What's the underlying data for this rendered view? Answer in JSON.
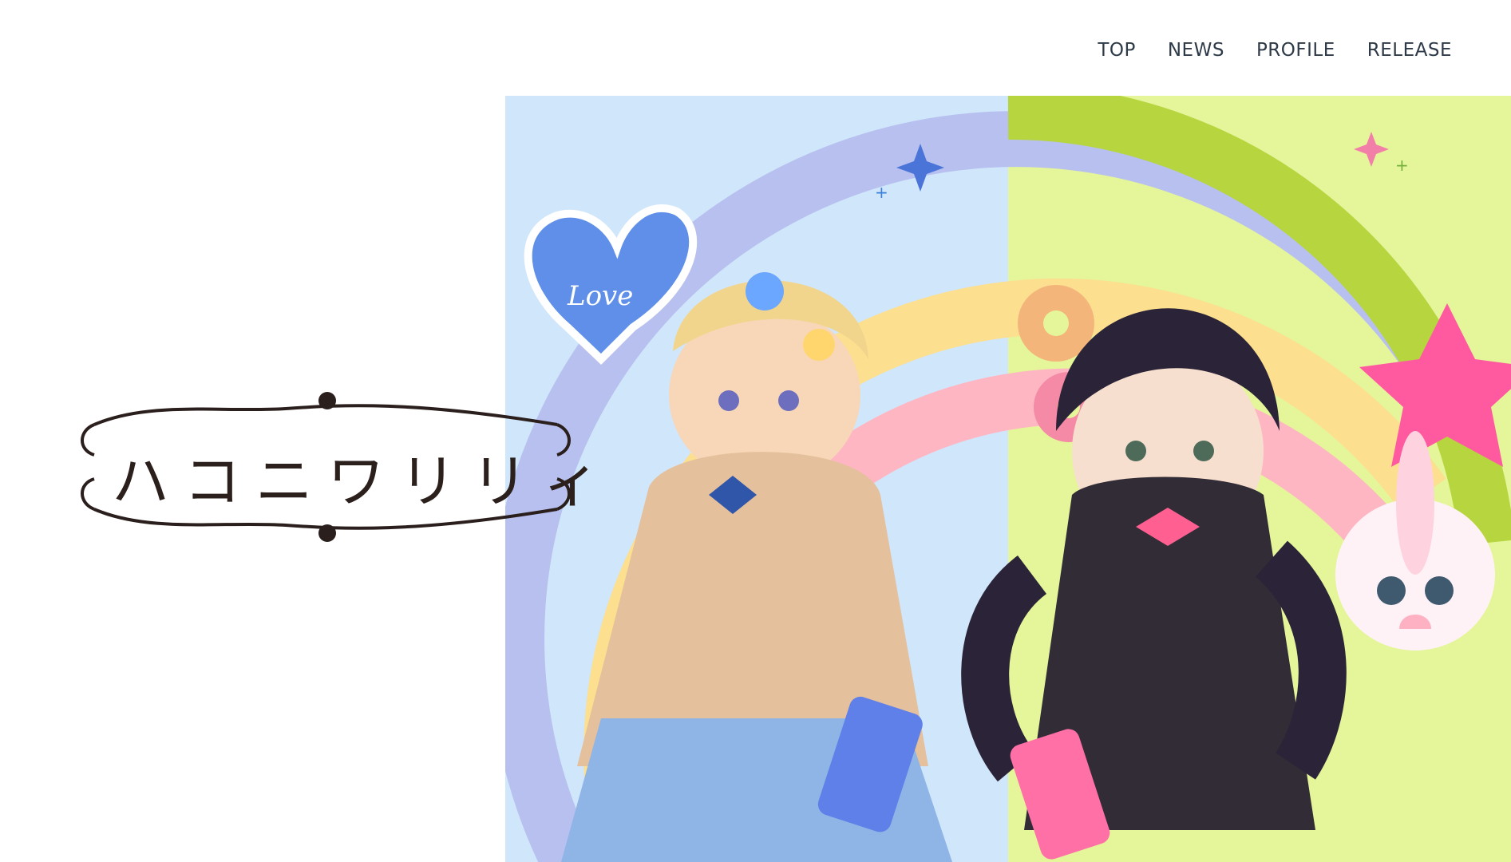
{
  "nav": {
    "items": [
      {
        "label": "TOP"
      },
      {
        "label": "NEWS"
      },
      {
        "label": "PROFILE"
      },
      {
        "label": "RELEASE"
      }
    ]
  },
  "logo": {
    "text": "ハコニワリリィ"
  },
  "hero": {
    "balloon_text": "Love",
    "colors": {
      "left_sky": "#d0e6fb",
      "right_sky": "#e5f59a",
      "rainbow_violet": "#b7c0ef",
      "rainbow_green": "#b7d53f",
      "rainbow_yellow": "#fcdf8f",
      "rainbow_pink": "#ffb6c3"
    }
  }
}
